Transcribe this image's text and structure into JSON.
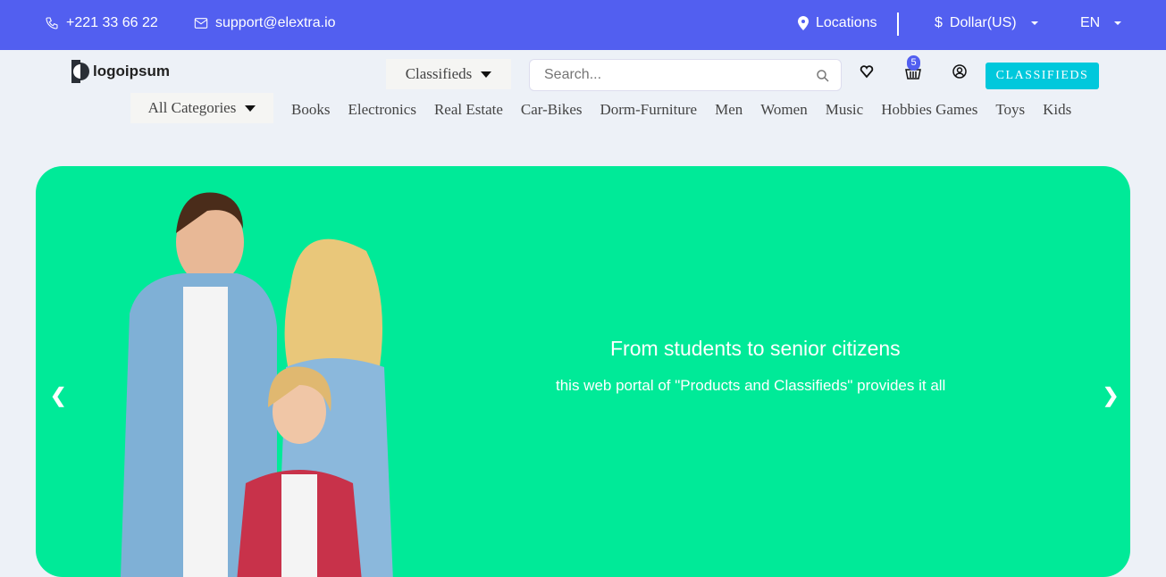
{
  "topbar": {
    "phone": "+221 33 66 22",
    "email": "support@elextra.io",
    "locations": "Locations",
    "currency": "Dollar(US)",
    "language": "EN"
  },
  "header": {
    "logo_text": "logoipsum",
    "type_select": "Classifieds",
    "search_placeholder": "Search...",
    "cart_count": "5",
    "classifieds_button": "CLASSIFIEDS"
  },
  "nav": {
    "all_categories": "All Categories",
    "items": [
      "Books",
      "Electronics",
      "Real Estate",
      "Car-Bikes",
      "Dorm-Furniture",
      "Men",
      "Women",
      "Music",
      "Hobbies Games",
      "Toys",
      "Kids"
    ]
  },
  "hero": {
    "title": "From students to senior citizens",
    "subtitle": "this web portal of \"Products and Classifieds\" provides it all",
    "prev": "❮",
    "next": "❯",
    "background": "#00ea98"
  },
  "colors": {
    "topbar": "#525ff0",
    "accent": "#00c8dc"
  }
}
